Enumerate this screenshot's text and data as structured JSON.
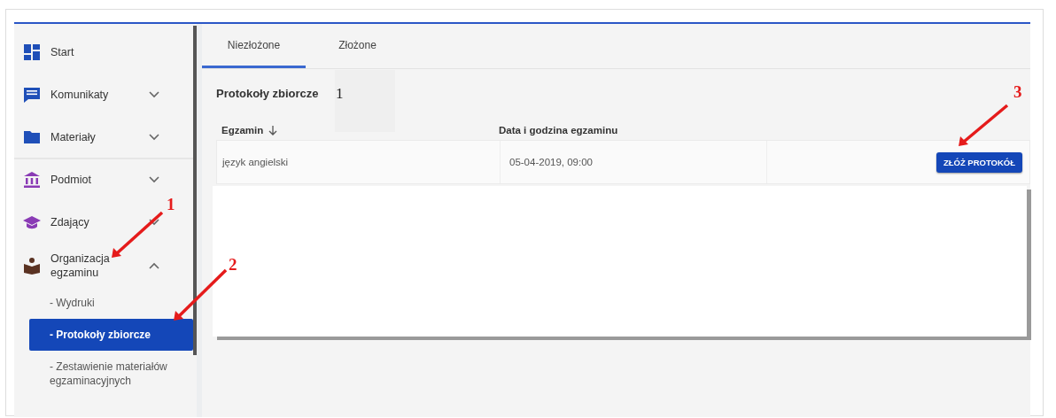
{
  "sidebar": {
    "items": [
      {
        "label": "Start"
      },
      {
        "label": "Komunikaty",
        "expanded": false
      },
      {
        "label": "Materiały",
        "expanded": false
      },
      {
        "label": "Podmiot",
        "expanded": false
      },
      {
        "label": "Zdający",
        "expanded": false
      },
      {
        "label": "Organizacja egzaminu",
        "expanded": true,
        "children": [
          {
            "label": "- Wydruki",
            "selected": false
          },
          {
            "label": "- Protokoły zbiorcze",
            "selected": true
          },
          {
            "label": "- Zestawienie materiałów egzaminacyjnych",
            "selected": false
          }
        ]
      }
    ]
  },
  "tabs": [
    {
      "label": "Niezłożone",
      "selected": true
    },
    {
      "label": "Złożone",
      "selected": false
    }
  ],
  "heading": "Protokoły zbiorcze",
  "table": {
    "columns": [
      {
        "label": "Egzamin",
        "sorted": true
      },
      {
        "label": "Data i godzina egzaminu",
        "sorted": false
      }
    ],
    "rows": [
      {
        "cells": [
          "język angielski",
          "05-04-2019, 09:00"
        ],
        "action": "ZŁÓŻ PROTOKÓŁ"
      }
    ]
  },
  "annotations": [
    {
      "label": "1"
    },
    {
      "label": "2"
    },
    {
      "label": "3"
    },
    {
      "label": "1"
    }
  ]
}
